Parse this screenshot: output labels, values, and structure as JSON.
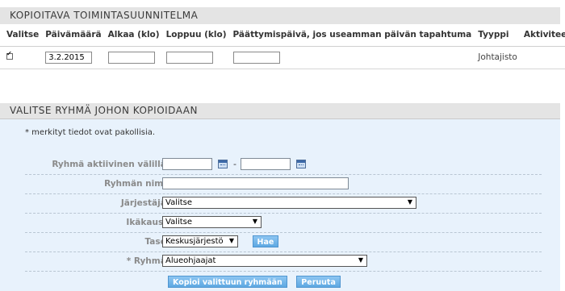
{
  "copy_plan": {
    "title": "KOPIOITAVA TOIMINTASUUNNITELMA",
    "columns": {
      "select": "Valitse",
      "date": "Päivämäärä",
      "start": "Alkaa (klo)",
      "end": "Loppuu (klo)",
      "end_date": "Päättymispäivä, jos useamman päivän tapahtuma",
      "type": "Tyyppi",
      "activities": "Aktiviteetit"
    },
    "rows": [
      {
        "checked": true,
        "date": "3.2.2015",
        "start": "",
        "end": "",
        "end_date": "",
        "type": "Johtajisto",
        "activities": ""
      }
    ]
  },
  "group_select": {
    "title": "VALITSE RYHMÄ JOHON KOPIOIDAAN",
    "required_note": "* merkityt tiedot ovat pakollisia.",
    "active_between_label": "Ryhmä aktiivinen välillä:",
    "active_from": "",
    "active_to": "",
    "range_separator": "-",
    "group_name_label": "Ryhmän nimi:",
    "group_name": "",
    "organizer_label": "Järjestäjä:",
    "organizer_value": "Valitse",
    "age_label": "Ikäkausi:",
    "age_value": "Valitse",
    "level_label": "Taso:",
    "level_value": "Keskusjärjestö",
    "search_button": "Hae",
    "group_label": "* Ryhmä:",
    "group_value": "Alueohjaajat",
    "copy_button": "Kopioi valittuun ryhmään",
    "cancel_button": "Peruuta"
  },
  "icons": {
    "calendar": "calendar-icon",
    "dropdown": "chevron-down-icon",
    "checkbox": "checkmark-icon"
  },
  "colors": {
    "header_bg": "#e4e4e4",
    "panel_bg": "#e8f2fc",
    "button_bg": "#5ea8e2"
  }
}
